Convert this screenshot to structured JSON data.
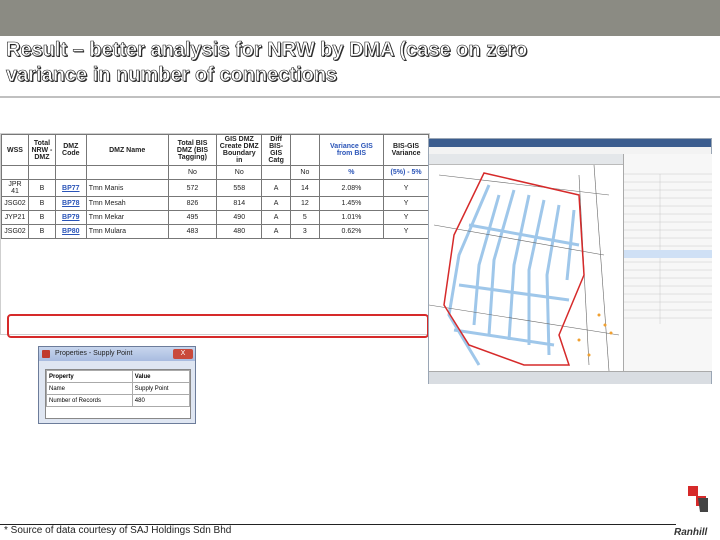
{
  "slide": {
    "title": "Result – better analysis for NRW by DMA (case on zero\nvariance in number of connections",
    "footnote": "* Source of data courtesy of SAJ Holdings Sdn Bhd",
    "logo": "Ranhill"
  },
  "table": {
    "headers": [
      "WSS",
      "Total\nNRW -\nDMZ",
      "DMZ\nCode",
      "DMZ\nName",
      "Total BIS DMZ\n(BIS Tagging)",
      "GIS DMZ\nCreate DMZ\nBoundary in",
      "Diff BIS-GIS\nCatg",
      "",
      "Variance GIS\nfrom BIS",
      "BIS-GIS\nVariance"
    ],
    "subheaders": [
      "",
      "",
      "",
      "",
      "No",
      "No",
      "",
      "No",
      "%",
      "(5%) - 5%"
    ],
    "rows": [
      {
        "wss": "JPR 41",
        "nrw": "B",
        "code": "BP77",
        "name": "Tmn Manis",
        "bis": "572",
        "gis": "558",
        "catg": "A",
        "diff": "14",
        "var": "2.08%",
        "res": "Y"
      },
      {
        "wss": "JSG02",
        "nrw": "B",
        "code": "BP78",
        "name": "Tmn Mesah",
        "bis": "826",
        "gis": "814",
        "catg": "A",
        "diff": "12",
        "var": "1.45%",
        "res": "Y"
      },
      {
        "wss": "JYP21",
        "nrw": "B",
        "code": "BP79",
        "name": "Tmn Mekar",
        "bis": "495",
        "gis": "490",
        "catg": "A",
        "diff": "5",
        "var": "1.01%",
        "res": "Y"
      },
      {
        "wss": "JSG02",
        "nrw": "B",
        "code": "BP80",
        "name": "Tmn Mulara",
        "bis": "483",
        "gis": "480",
        "catg": "A",
        "diff": "3",
        "var": "0.62%",
        "res": "Y"
      }
    ]
  },
  "dialog": {
    "title": "Properties - Supply Point",
    "close": "X",
    "headers": [
      "Property",
      "Value"
    ],
    "rows": [
      [
        "Name",
        "Supply Point"
      ],
      [
        "Number of Records",
        "480"
      ]
    ]
  },
  "colors": {
    "accent_red": "#d62a2a",
    "link_blue": "#2a54b8",
    "topbar": "#8b8b83"
  }
}
